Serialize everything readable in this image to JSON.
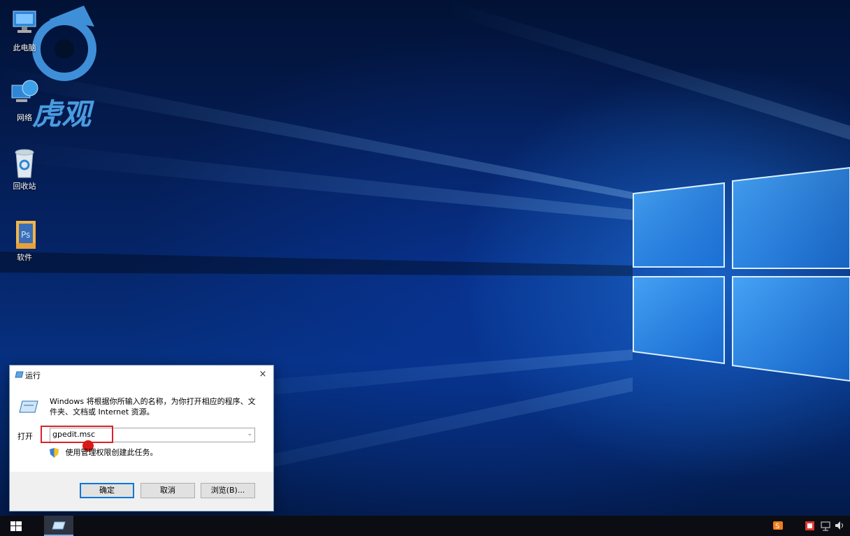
{
  "desktop": {
    "icons": [
      {
        "label": "此电脑",
        "icon": "this-pc-icon"
      },
      {
        "label": "网络",
        "icon": "network-icon"
      },
      {
        "label": "回收站",
        "icon": "recycle-bin-icon"
      },
      {
        "label": "软件",
        "icon": "folder-icon"
      }
    ],
    "watermark_text": "虎观"
  },
  "run_dialog": {
    "title": "运行",
    "description": "Windows 将根据你所输入的名称，为你打开相应的程序、文件夹、文档或 Internet 资源。",
    "open_label": "打开",
    "input_value": "gpedit.msc",
    "admin_note": "使用管理权限创建此任务。",
    "ok_label": "确定",
    "cancel_label": "取消",
    "browse_label": "浏览(B)...",
    "close_glyph": "×"
  },
  "colors": {
    "highlight": "#d9222a",
    "accent": "#0078d7",
    "taskbar": "#0b0d12"
  }
}
